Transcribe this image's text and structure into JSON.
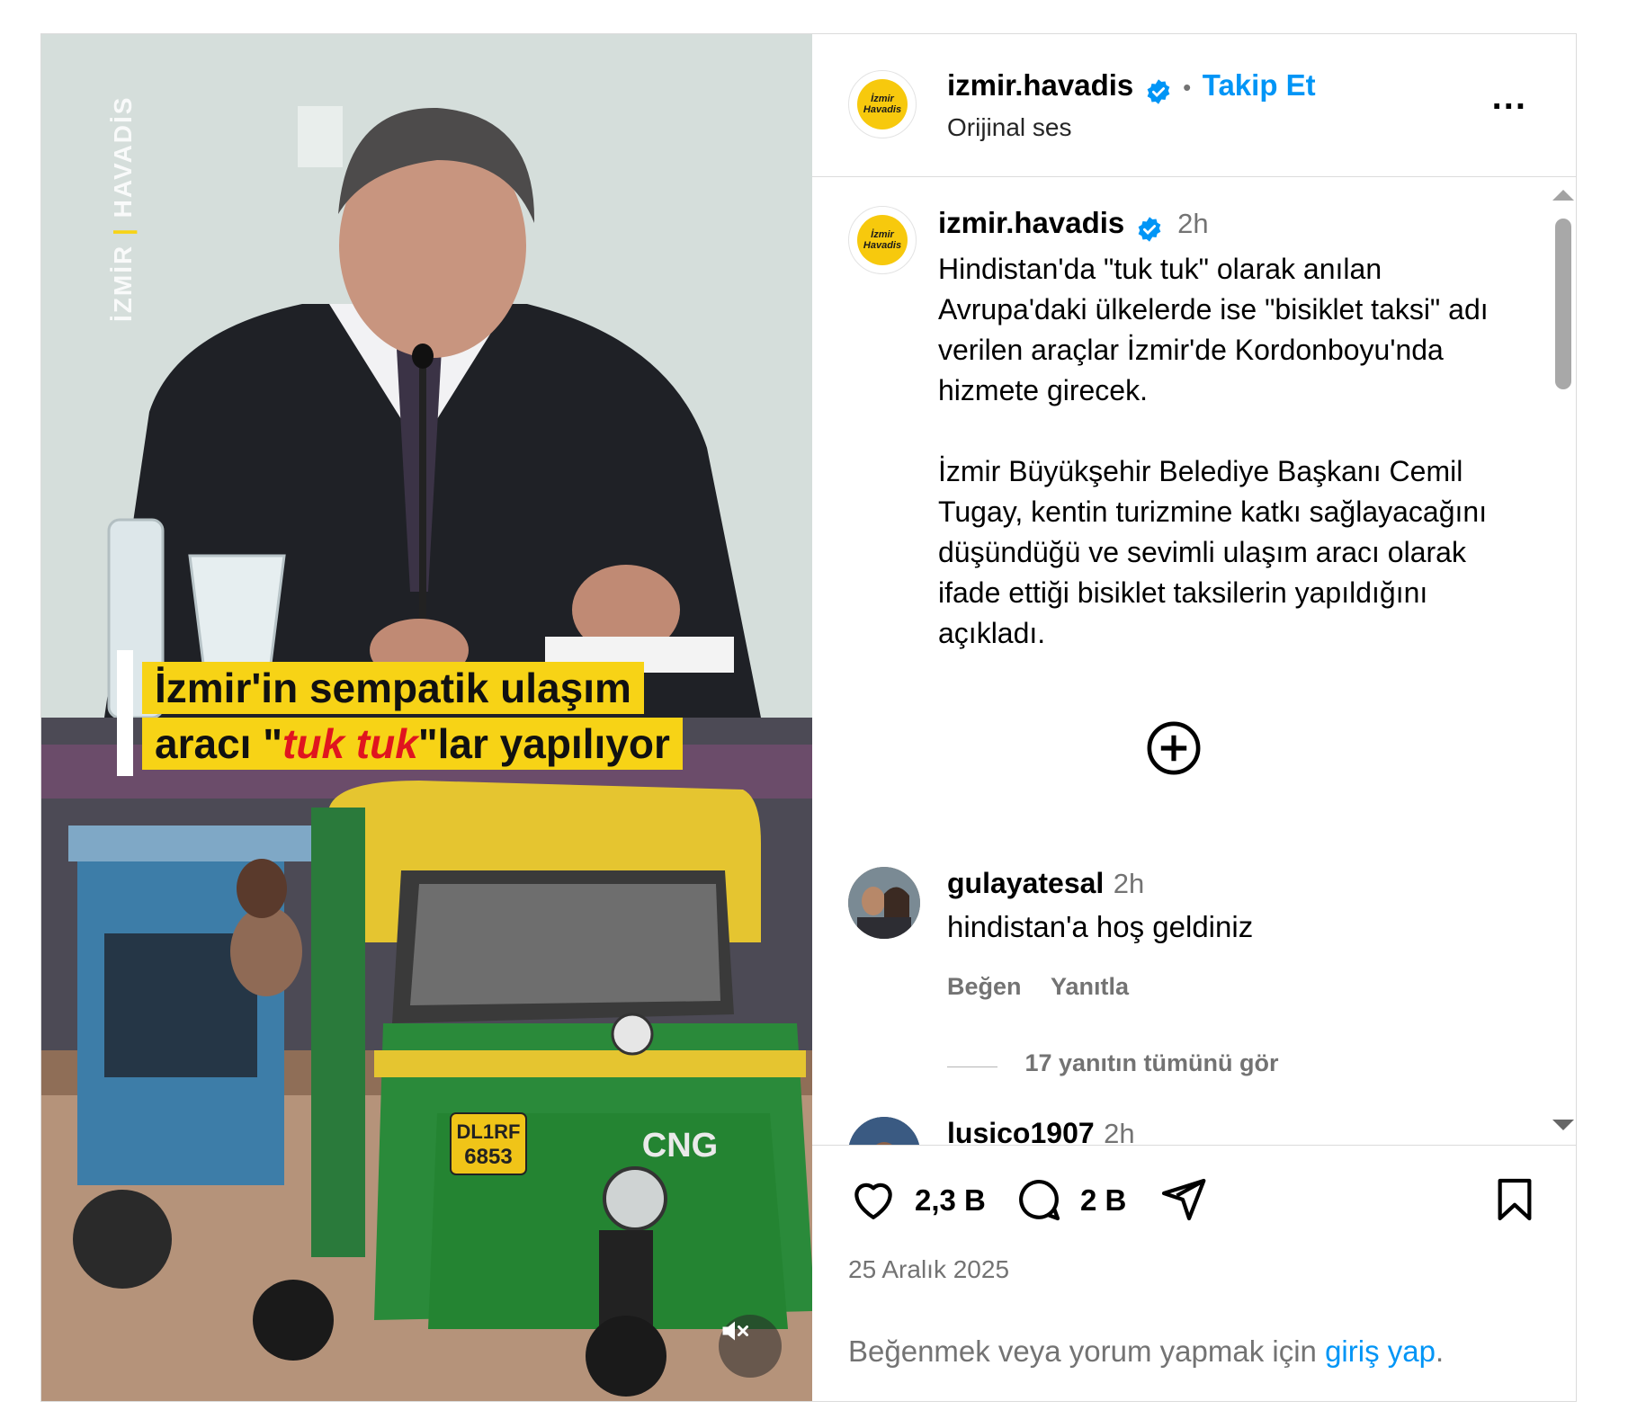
{
  "media": {
    "watermark_left": "İZMİR",
    "watermark_sep": "|",
    "watermark_right": "HAVADİS",
    "caption_line1": "İzmir'in sempatik ulaşım",
    "caption_line2_pre": "aracı \"",
    "caption_line2_red": "tuk tuk",
    "caption_line2_post": "\"lar yapılıyor",
    "plate_line1": "DL1RF",
    "plate_line2": "6853",
    "vehicle_label": "CNG",
    "mute_icon": "muted-speaker-icon"
  },
  "header": {
    "logo_text": "İzmir\nHavadis",
    "username": "izmir.havadis",
    "dot": "•",
    "follow_label": "Takip Et",
    "audio_label": "Orijinal ses",
    "more_label": "..."
  },
  "caption": {
    "username": "izmir.havadis",
    "time": "2h",
    "text": "Hindistan'da \"tuk tuk\" olarak anılan Avrupa'daki ülkelerde ise \"bisiklet taksi\" adı verilen araçlar İzmir'de Kordonboyu'nda hizmete girecek.\n\nİzmir Büyükşehir Belediye Başkanı Cemil Tugay, kentin turizmine katkı sağlayacağını düşündüğü ve sevimli ulaşım aracı olarak ifade ettiği bisiklet taksilerin yapıldığını açıkladı."
  },
  "comments": [
    {
      "username": "gulayatesal",
      "time": "2h",
      "text": "hindistan'a hoş geldiniz",
      "like_label": "Beğen",
      "reply_label": "Yanıtla",
      "view_replies": "17 yanıtın tümünü gör"
    },
    {
      "username": "lusico1907",
      "time": "2h"
    }
  ],
  "actions": {
    "likes": "2,3 B",
    "comments": "2 B",
    "date": "25 Aralık 2025",
    "login_prefix": "Beğenmek veya yorum yapmak için",
    "login_link": "giriş yap",
    "login_suffix": "."
  },
  "colors": {
    "accent": "#0095f6",
    "verified": "#0095f6",
    "caption_yellow": "#f7d316",
    "caption_red": "#e0151f",
    "muted_text": "#737373"
  }
}
